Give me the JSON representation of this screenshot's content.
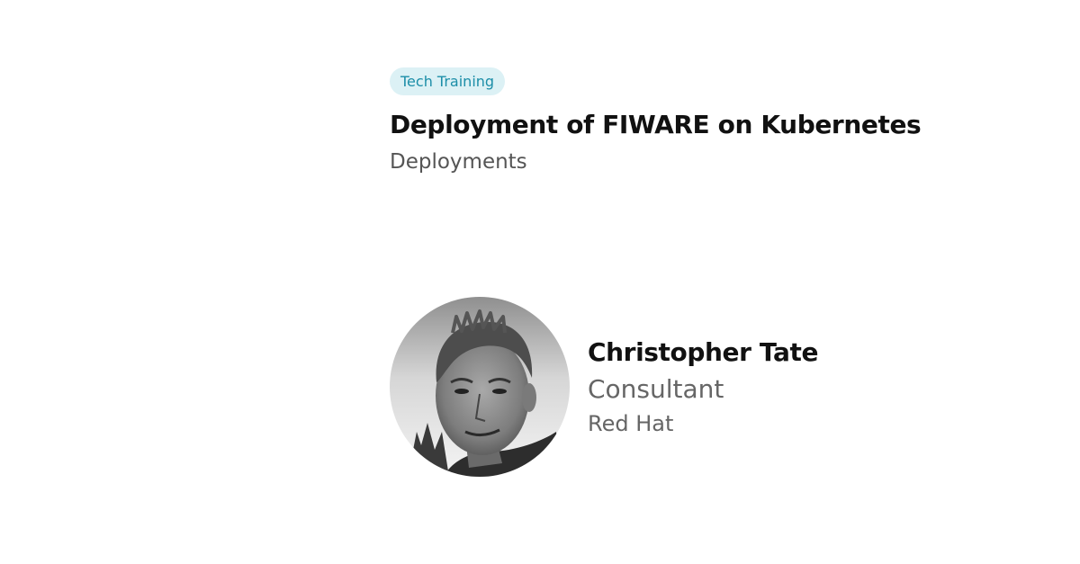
{
  "session": {
    "category": "Tech Training",
    "title": "Deployment of FIWARE on Kubernetes",
    "track": "Deployments"
  },
  "speaker": {
    "name": "Christopher Tate",
    "role": "Consultant",
    "company": "Red Hat",
    "photo": "grayscale-headshot"
  },
  "colors": {
    "badge_bg": "#dcf1f5",
    "badge_text": "#1c8ea8",
    "title_text": "#111111",
    "secondary_text": "#666666"
  }
}
